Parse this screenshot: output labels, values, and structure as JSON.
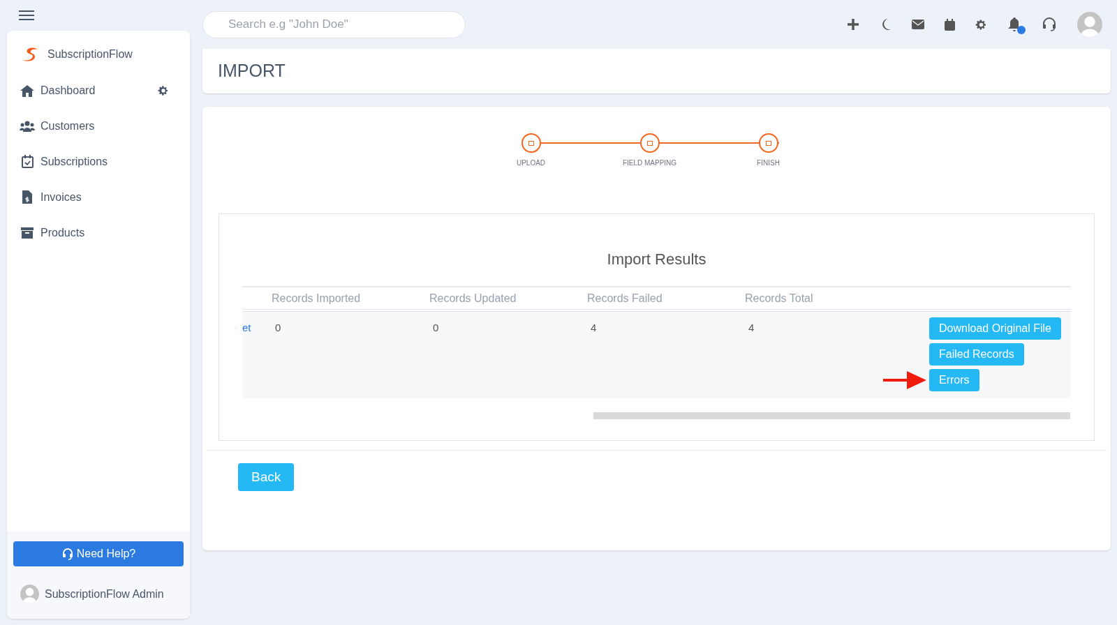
{
  "topbar": {
    "search": {
      "placeholder": "Search e.g \"John Doe\""
    },
    "notification_badge": true
  },
  "sidebar": {
    "brand": "SubscriptionFlow",
    "items": [
      {
        "label": "Dashboard",
        "has_settings": true
      },
      {
        "label": "Customers",
        "has_settings": false
      },
      {
        "label": "Subscriptions",
        "has_settings": false
      },
      {
        "label": "Invoices",
        "has_settings": false
      },
      {
        "label": "Products",
        "has_settings": false
      }
    ],
    "help_button": "Need Help?",
    "user": "SubscriptionFlow Admin"
  },
  "page_title": "IMPORT",
  "steps": [
    "UPLOAD",
    "FIELD MAPPING",
    "FINISH"
  ],
  "results": {
    "title": "Import Results",
    "columns": [
      "Records Imported",
      "Records Updated",
      "Records Failed",
      "Records Total"
    ],
    "rows": [
      {
        "column_1": "et",
        "cells": [
          "0",
          "0",
          "4",
          "4"
        ],
        "actions": [
          {
            "label": "Download Original File",
            "highlighted": false
          },
          {
            "label": "Failed Records",
            "highlighted": false
          },
          {
            "label": "Errors",
            "highlighted": true
          }
        ]
      }
    ]
  },
  "back_button": "Back"
}
